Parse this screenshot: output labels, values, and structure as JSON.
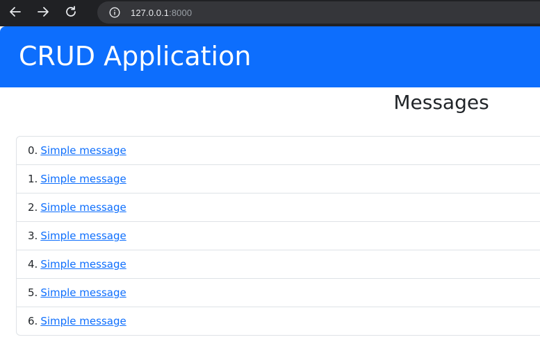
{
  "browser": {
    "url_host": "127.0.0.1",
    "url_port": ":8000",
    "icons": [
      "back-arrow-icon",
      "forward-arrow-icon",
      "reload-icon",
      "info-icon"
    ]
  },
  "header": {
    "title": "CRUD Application"
  },
  "main": {
    "heading": "Messages",
    "messages": [
      {
        "index": "0.",
        "text": "Simple message"
      },
      {
        "index": "1.",
        "text": "Simple message"
      },
      {
        "index": "2.",
        "text": "Simple message"
      },
      {
        "index": "3.",
        "text": "Simple message"
      },
      {
        "index": "4.",
        "text": "Simple message"
      },
      {
        "index": "5.",
        "text": "Simple message"
      },
      {
        "index": "6.",
        "text": "Simple message"
      }
    ]
  },
  "colors": {
    "header_bg": "#0d6efd",
    "link": "#0d6efd",
    "browser_bg": "#202124"
  }
}
